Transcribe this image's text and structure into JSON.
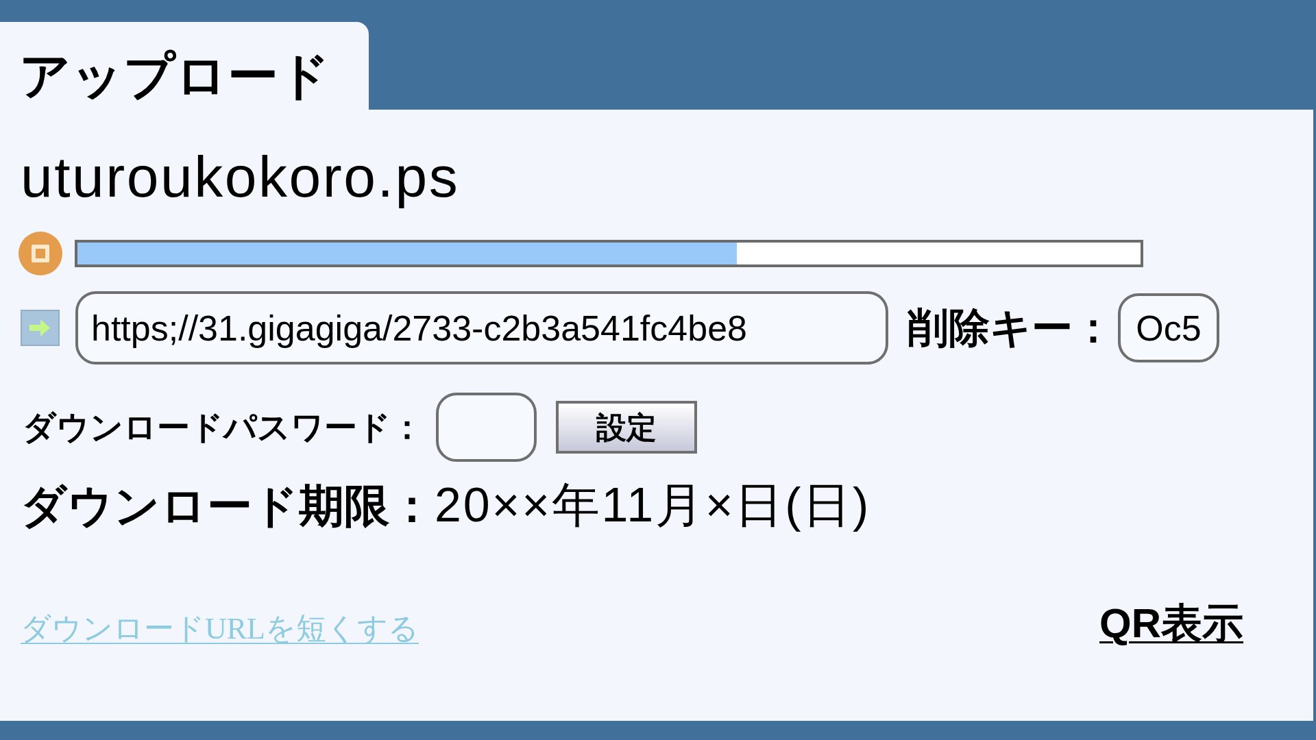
{
  "tab": {
    "title": "アップロード"
  },
  "file": {
    "name": "uturoukokoro.ps"
  },
  "progress": {
    "level": 0.62
  },
  "url_field": {
    "value": "https;//31.gigagiga/2733-c2b3a541fc4be8"
  },
  "delete_key": {
    "label": "削除キー：",
    "value": "Oc5"
  },
  "password": {
    "label": "ダウンロードパスワード：",
    "button": "設定"
  },
  "expiry": {
    "label": "ダウンロード期限：",
    "value": "20××年11月×日(日)"
  },
  "links": [
    {
      "kind": "pale",
      "text": "ダウンロードURLを短くする"
    },
    {
      "kind": "bold",
      "text": "QR表示"
    }
  ]
}
